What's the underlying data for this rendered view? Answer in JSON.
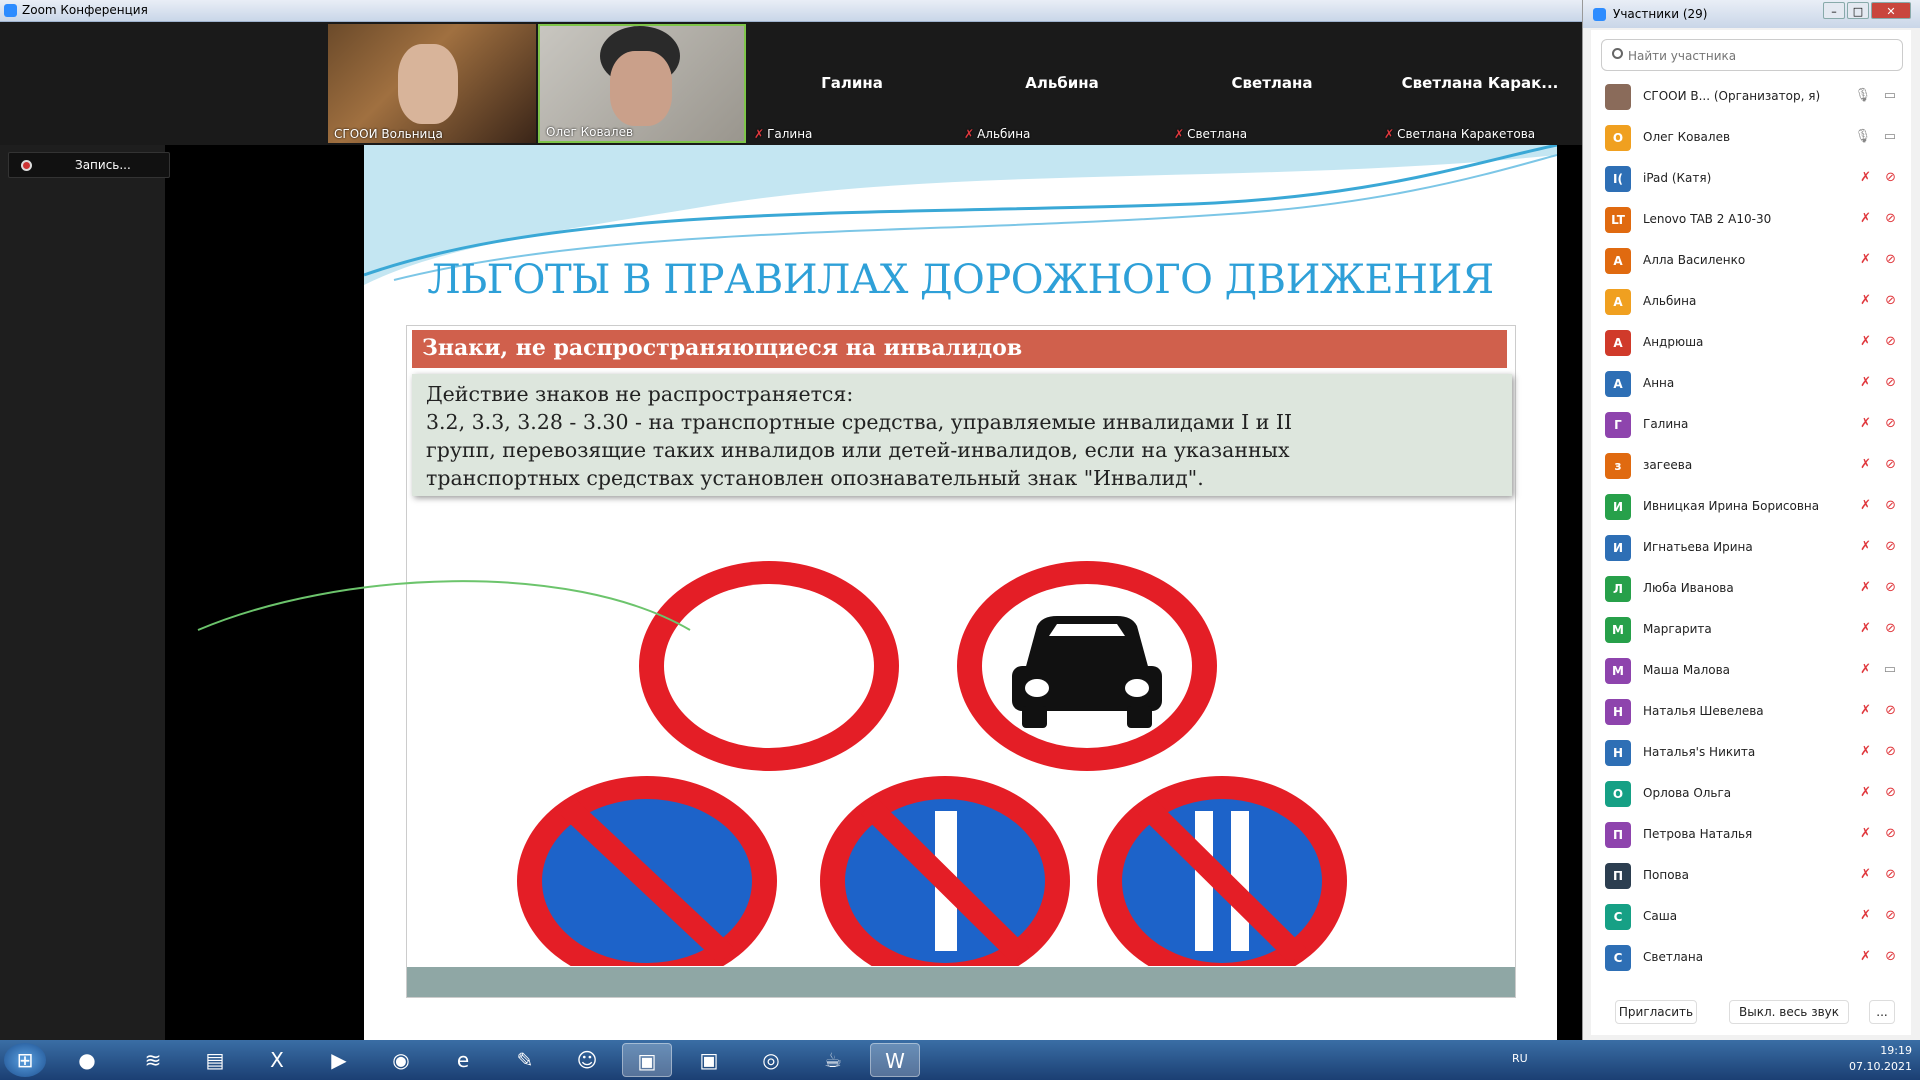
{
  "window": {
    "title": "Zoom Конференция"
  },
  "videos": [
    {
      "name": "СГООИ Вольница",
      "type": "video"
    },
    {
      "name": "Олег Ковалев",
      "type": "video"
    },
    {
      "name": "Галина",
      "label": "Галина",
      "type": "name"
    },
    {
      "name": "Альбина",
      "label": "Альбина",
      "type": "name"
    },
    {
      "name": "Светлана",
      "label": "Светлана",
      "type": "name"
    },
    {
      "name": "Светлана Каракетова",
      "label": "Светлана  Карак...",
      "type": "name"
    }
  ],
  "recording": {
    "label": "Запись..."
  },
  "slide": {
    "title": "ЛЬГОТЫ В ПРАВИЛАХ ДОРОЖНОГО ДВИЖЕНИЯ",
    "box_header": "Знаки, не распространяющиеся на инвалидов",
    "text_line1": "Действие знаков не распространяется:",
    "text_line2": "3.2, 3.3, 3.28 - 3.30 - на транспортные средства, управляемые инвалидами I и II",
    "text_line3": "групп, перевозящие таких инвалидов или детей-инвалидов, если на указанных",
    "text_line4": "транспортных средствах установлен опознавательный знак \"Инвалид\"."
  },
  "participants": {
    "title": "Участники (29)",
    "search_placeholder": "Найти участника",
    "list": [
      {
        "name": "СГООИ В...  (Организатор, я)",
        "initial": "",
        "color": "#8a6b5a",
        "mic": "on",
        "cam": "on"
      },
      {
        "name": "Олег Ковалев",
        "initial": "О",
        "color": "#f0a020",
        "mic": "on",
        "cam": "on"
      },
      {
        "name": "iPad (Катя)",
        "initial": "I(",
        "color": "#2e6fb5",
        "mic": "off",
        "cam": "off"
      },
      {
        "name": "Lenovo TAB 2 A10-30",
        "initial": "LT",
        "color": "#e06a10",
        "mic": "off",
        "cam": "off"
      },
      {
        "name": "Алла Василенко",
        "initial": "А",
        "color": "#e06a10",
        "mic": "off",
        "cam": "off"
      },
      {
        "name": "Альбина",
        "initial": "А",
        "color": "#f0a020",
        "mic": "off",
        "cam": "off"
      },
      {
        "name": "Андрюша",
        "initial": "А",
        "color": "#d03a2a",
        "mic": "off",
        "cam": "off"
      },
      {
        "name": "Анна",
        "initial": "А",
        "color": "#2e6fb5",
        "mic": "off",
        "cam": "off"
      },
      {
        "name": "Галина",
        "initial": "Г",
        "color": "#8e44ad",
        "mic": "off",
        "cam": "off"
      },
      {
        "name": "загеева",
        "initial": "з",
        "color": "#e06a10",
        "mic": "off",
        "cam": "off"
      },
      {
        "name": "Ивницкая Ирина Борисовна",
        "initial": "И",
        "color": "#27a04a",
        "mic": "off",
        "cam": "off"
      },
      {
        "name": "Игнатьева Ирина",
        "initial": "И",
        "color": "#2e6fb5",
        "mic": "off",
        "cam": "off"
      },
      {
        "name": "Люба Иванова",
        "initial": "Л",
        "color": "#27a04a",
        "mic": "off",
        "cam": "off"
      },
      {
        "name": "Маргарита",
        "initial": "М",
        "color": "#27a04a",
        "mic": "off",
        "cam": "off"
      },
      {
        "name": "Маша Малова",
        "initial": "М",
        "color": "#8e44ad",
        "mic": "off",
        "cam": "on"
      },
      {
        "name": "Наталья Шевелева",
        "initial": "Н",
        "color": "#8e44ad",
        "mic": "off",
        "cam": "off"
      },
      {
        "name": "Наталья's  Никита",
        "initial": "Н",
        "color": "#2e6fb5",
        "mic": "off",
        "cam": "off"
      },
      {
        "name": "Орлова Ольга",
        "initial": "О",
        "color": "#16a085",
        "mic": "off",
        "cam": "off"
      },
      {
        "name": "Петрова Наталья",
        "initial": "П",
        "color": "#8e44ad",
        "mic": "off",
        "cam": "off"
      },
      {
        "name": "Попова",
        "initial": "П",
        "color": "#2c3e50",
        "mic": "off",
        "cam": "off"
      },
      {
        "name": "Саша",
        "initial": "С",
        "color": "#16a085",
        "mic": "off",
        "cam": "off"
      },
      {
        "name": "Светлана",
        "initial": "С",
        "color": "#2e6fb5",
        "mic": "off",
        "cam": "off"
      }
    ],
    "invite_label": "Пригласить",
    "mute_all_label": "Выкл. весь звук",
    "more_label": "..."
  },
  "taskbar": {
    "lang": "RU",
    "time": "19:19",
    "date": "07.10.2021"
  }
}
